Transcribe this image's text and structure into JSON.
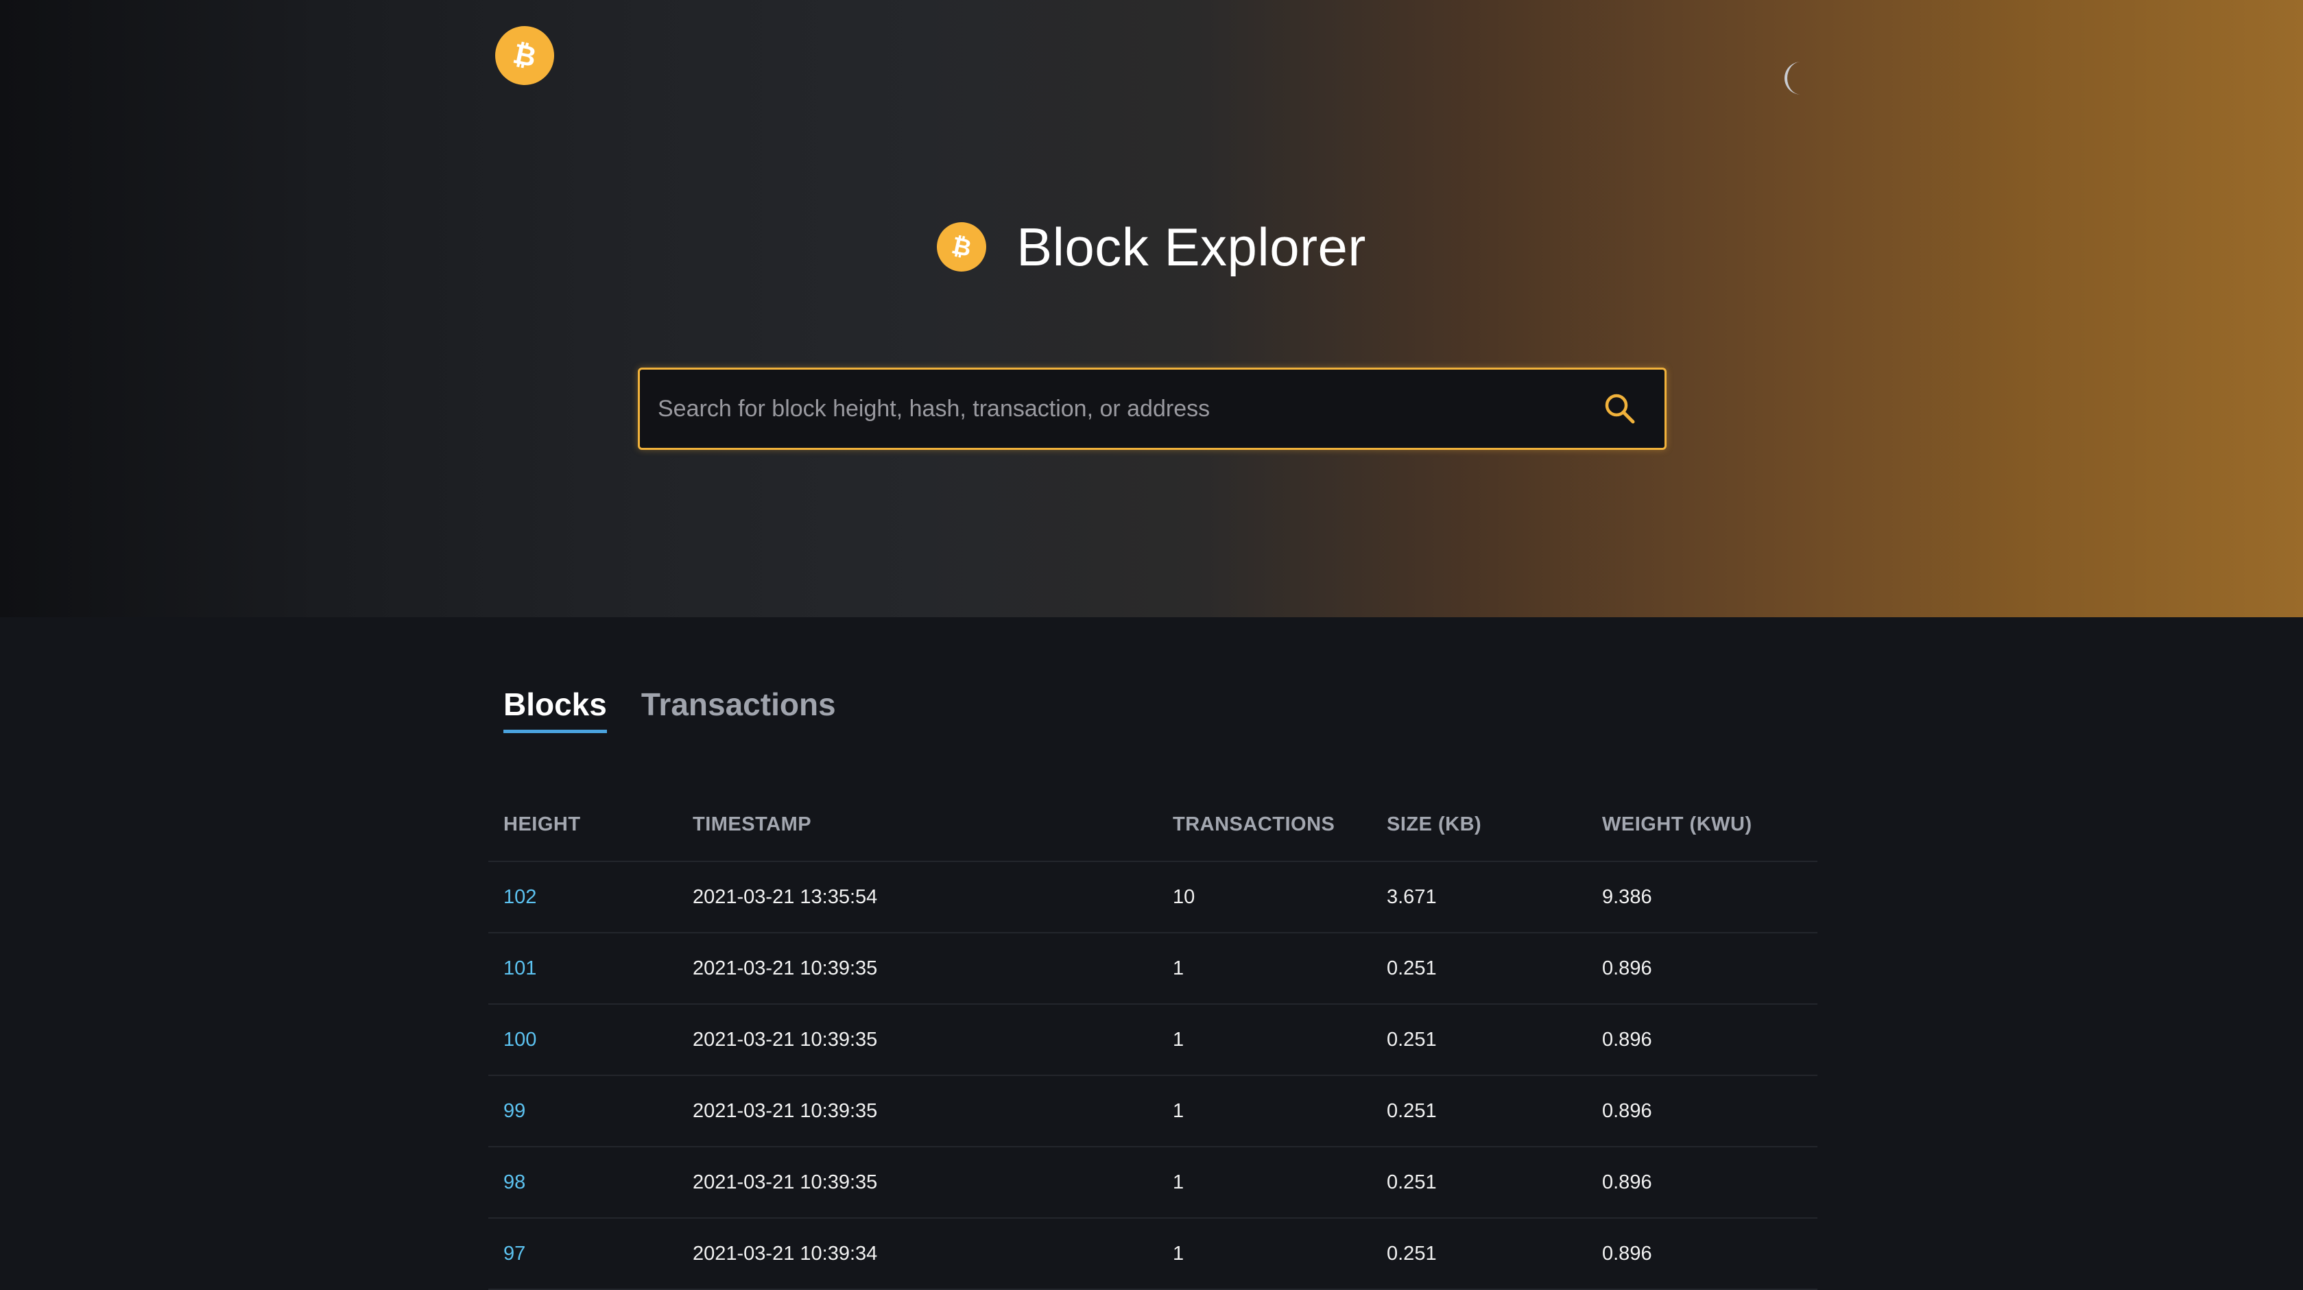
{
  "brand": {
    "logo_icon": "bitcoin-logo-icon",
    "accent": "#f7b339"
  },
  "header": {
    "theme_toggle_icon": "moon-icon"
  },
  "hero": {
    "title": "Block Explorer"
  },
  "search": {
    "placeholder": "Search for block height, hash, transaction, or address",
    "value": "",
    "icon": "search-icon"
  },
  "tabs": [
    {
      "label": "Blocks",
      "active": true
    },
    {
      "label": "Transactions",
      "active": false
    }
  ],
  "table": {
    "columns": [
      "HEIGHT",
      "TIMESTAMP",
      "TRANSACTIONS",
      "SIZE (KB)",
      "WEIGHT (KWU)"
    ],
    "rows": [
      {
        "height": "102",
        "timestamp": "2021-03-21 13:35:54",
        "transactions": "10",
        "size": "3.671",
        "weight": "9.386"
      },
      {
        "height": "101",
        "timestamp": "2021-03-21 10:39:35",
        "transactions": "1",
        "size": "0.251",
        "weight": "0.896"
      },
      {
        "height": "100",
        "timestamp": "2021-03-21 10:39:35",
        "transactions": "1",
        "size": "0.251",
        "weight": "0.896"
      },
      {
        "height": "99",
        "timestamp": "2021-03-21 10:39:35",
        "transactions": "1",
        "size": "0.251",
        "weight": "0.896"
      },
      {
        "height": "98",
        "timestamp": "2021-03-21 10:39:35",
        "transactions": "1",
        "size": "0.251",
        "weight": "0.896"
      },
      {
        "height": "97",
        "timestamp": "2021-03-21 10:39:34",
        "transactions": "1",
        "size": "0.251",
        "weight": "0.896"
      }
    ]
  }
}
